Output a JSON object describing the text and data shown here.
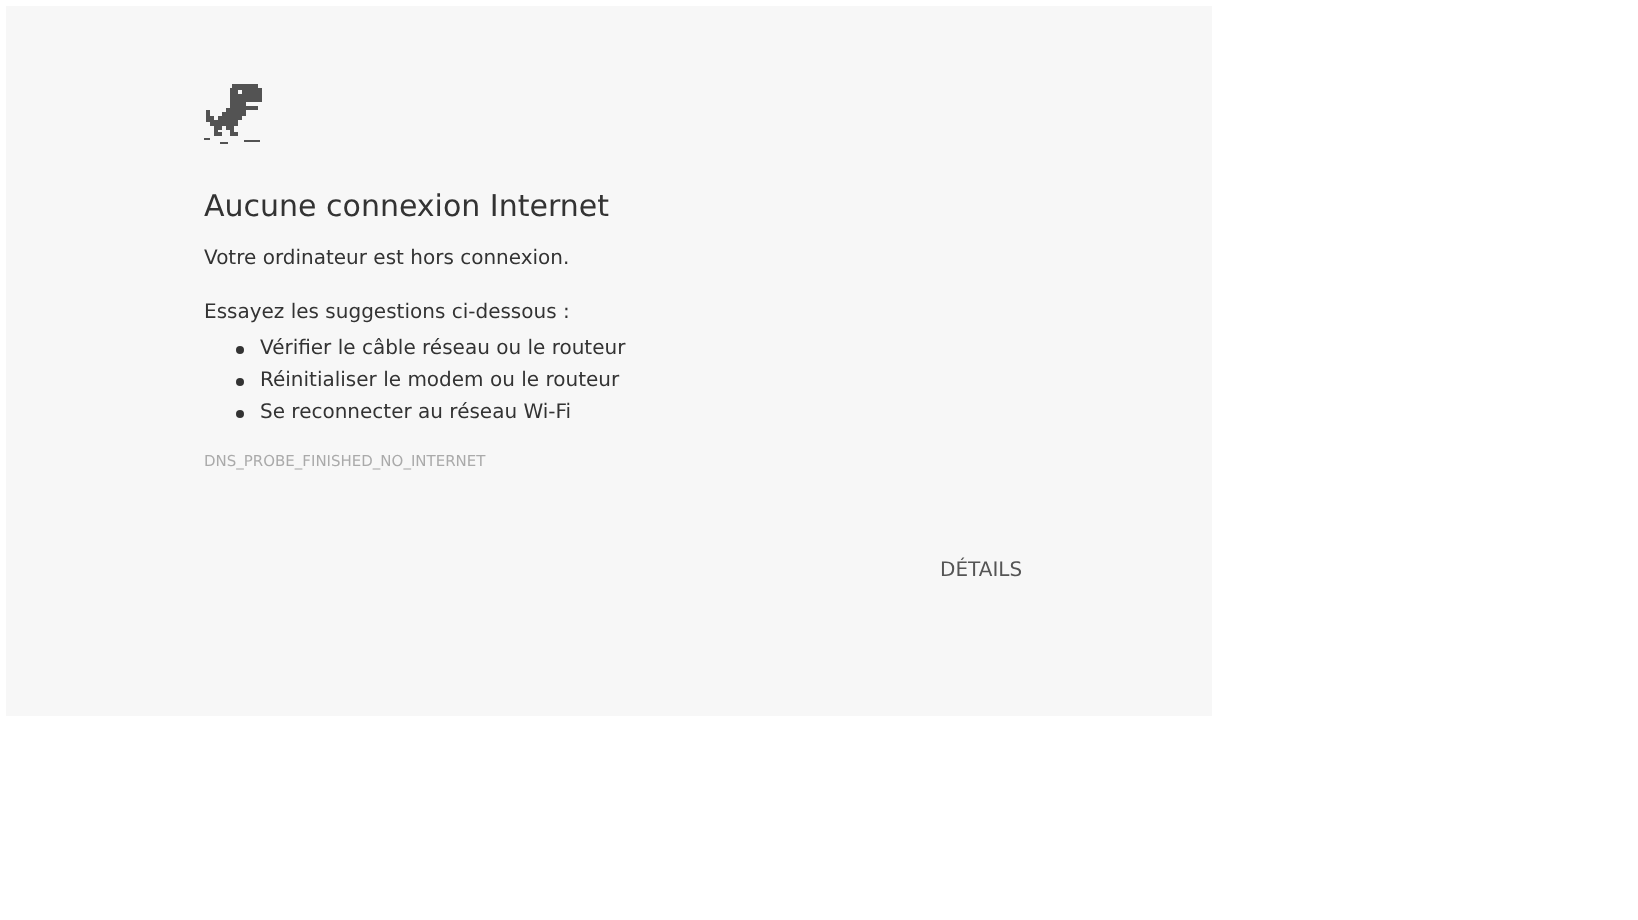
{
  "title": "Aucune connexion Internet",
  "message": "Votre ordinateur est hors connexion.",
  "suggestions_intro": "Essayez les suggestions ci-dessous :",
  "suggestions": [
    "Vérifier le câble réseau ou le routeur",
    "Réinitialiser le modem ou le routeur",
    "Se reconnecter au réseau Wi-Fi"
  ],
  "error_code": "DNS_PROBE_FINISHED_NO_INTERNET",
  "details_button": "DÉTAILS"
}
